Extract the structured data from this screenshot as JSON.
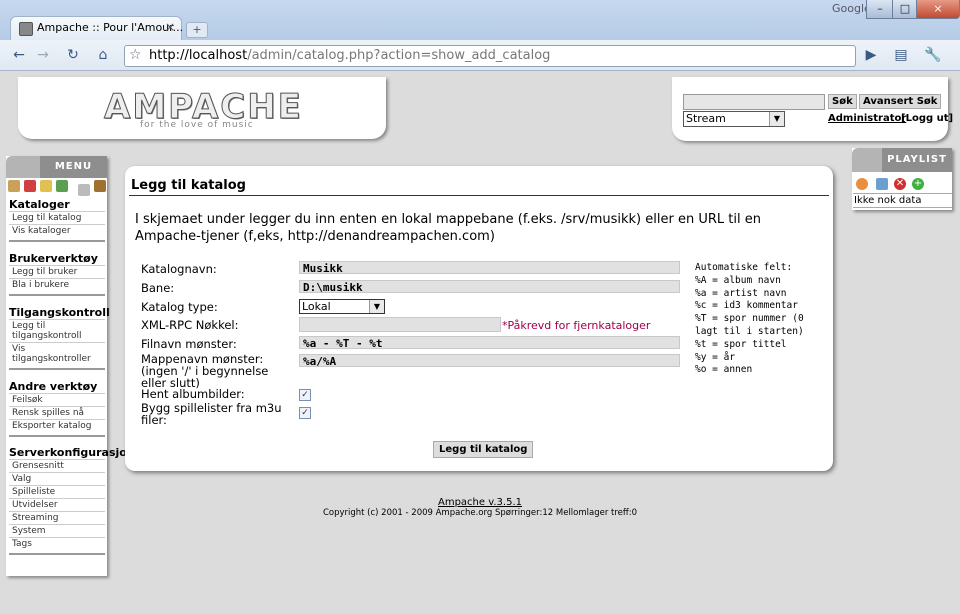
{
  "browser": {
    "tab_title": "Ampache :: Pour l'Amour...",
    "tab_close": "×",
    "new_tab": "+",
    "brand": "Google",
    "url_host": "http://localhost",
    "url_path": "/admin/catalog.php?action=show_add_catalog",
    "window_min": "–",
    "window_max": "□",
    "window_close": "×"
  },
  "header": {
    "logo": "AMPACHE",
    "tagline": "for the love of music",
    "search_button": "Søk",
    "advanced_search_button": "Avansert Søk",
    "stream_select": "Stream",
    "admin_link": "Administrator",
    "logout_link": "[Logg ut]"
  },
  "sidebar": {
    "menu_label": "MENU",
    "sections": [
      {
        "title": "Kataloger",
        "items": [
          "Legg til katalog",
          "Vis kataloger"
        ]
      },
      {
        "title": "Brukerverktøy",
        "items": [
          "Legg til bruker",
          "Bla i brukere"
        ]
      },
      {
        "title": "Tilgangskontroll",
        "items": [
          "Legg til tilgangskontroll",
          "Vis tilgangskontroller"
        ]
      },
      {
        "title": "Andre verktøy",
        "items": [
          "Feilsøk",
          "Rensk spilles nå",
          "Eksporter katalog"
        ]
      },
      {
        "title": "Serverkonfigurasjon",
        "items": [
          "Grensesnitt",
          "Valg",
          "Spilleliste",
          "Utvidelser",
          "Streaming",
          "System",
          "Tags"
        ]
      }
    ]
  },
  "main": {
    "title": "Legg til katalog",
    "intro": "I skjemaet under legger du inn enten en lokal mappebane (f.eks. /srv/musikk) eller en URL til en Ampache-tjener (f,eks, http://denandreampachen.com)",
    "fields": {
      "catalog_name_label": "Katalognavn:",
      "catalog_name_value": "Musikk",
      "path_label": "Bane:",
      "path_value": "D:\\musikk",
      "type_label": "Katalog type:",
      "type_value": "Lokal",
      "xmlrpc_label": "XML-RPC Nøkkel:",
      "xmlrpc_note": "*Påkrevd for fjernkataloger",
      "filename_label": "Filnavn mønster:",
      "filename_value": "%a - %T - %t",
      "folder_label": "Mappenavn mønster: (ingen '/' i begynnelse eller slutt)",
      "folder_value": "%a/%A",
      "albumart_label": "Hent albumbilder:",
      "m3u_label": "Bygg spillelister fra m3u filer:"
    },
    "albumart_checked": true,
    "m3u_checked": true,
    "submit_label": "Legg til katalog",
    "auto_fields": "Automatiske felt:\n%A = album navn\n%a = artist navn\n%c = id3 kommentar\n%T = spor nummer (0\nlagt til i starten)\n%t = spor tittel\n%y = år\n%o = annen"
  },
  "playlist": {
    "label": "PLAYLIST",
    "empty_text": "Ikke nok data"
  },
  "footer": {
    "version": "Ampache v.3.5.1",
    "copyright": "Copyright (c) 2001 - 2009 Ampache.org Spørringer:12 Mellomlager treff:0"
  }
}
